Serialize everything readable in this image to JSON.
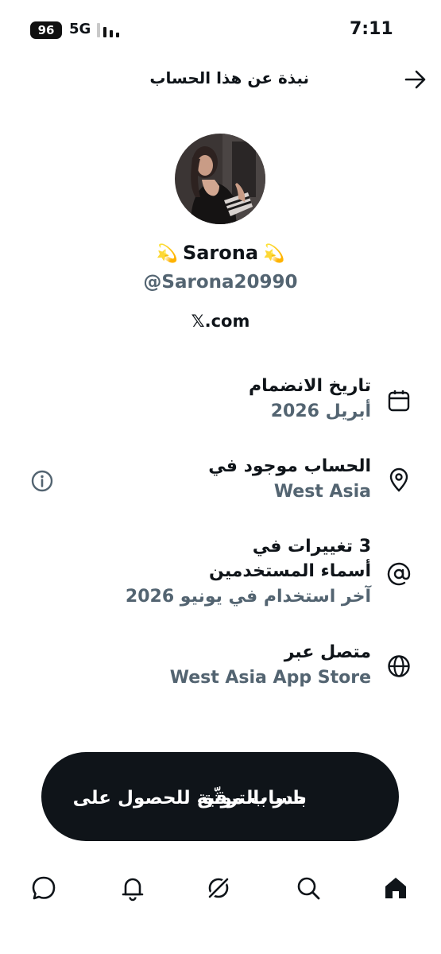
{
  "status_bar": {
    "battery": "96",
    "network": "5G",
    "time": "7:11"
  },
  "header": {
    "title": "نبذة عن هذا الحساب",
    "back_icon": "arrow-right-icon"
  },
  "profile": {
    "name": "Sarona",
    "name_emoji": "💫",
    "handle": "@Sarona20990",
    "website": "𝕏.com"
  },
  "info": {
    "joined": {
      "label": "تاريخ الانضمام",
      "value": "أبريل 2026",
      "icon": "calendar-icon"
    },
    "location": {
      "label": "الحساب موجود في",
      "value": "West Asia",
      "icon": "location-pin-icon"
    },
    "username_changes": {
      "label_line1": "3 تغييرات في",
      "label_line2": "أسماء المستخدمين",
      "value": "آخر استخدام في يونيو 2026",
      "icon": "at-icon"
    },
    "connected": {
      "label": "متصل عبر",
      "value": "West Asia App Store",
      "icon": "globe-icon"
    }
  },
  "upgrade_button": {
    "line1": "بادر بالترقية للحصول على",
    "line2": "حساب موثّق"
  },
  "bottom_nav": [
    "home-icon",
    "search-icon",
    "grok-icon",
    "notifications-icon",
    "messages-icon"
  ],
  "colors": {
    "primary_text": "#0f1419",
    "secondary_text": "#536471",
    "button_bg": "#0f1419"
  }
}
